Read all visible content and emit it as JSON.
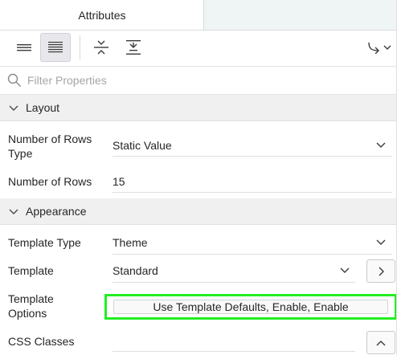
{
  "tabs": [
    {
      "label": "Attributes"
    }
  ],
  "toolbar": {
    "buttons": [
      {
        "name": "show-common-icon"
      },
      {
        "name": "show-all-icon"
      },
      {
        "name": "collapse-all-icon"
      },
      {
        "name": "expand-all-icon"
      },
      {
        "name": "go-to-group-icon"
      }
    ]
  },
  "filter": {
    "placeholder": "Filter Properties",
    "value": ""
  },
  "sections": {
    "layout": {
      "title": "Layout",
      "rows": [
        {
          "label_line1": "Number of Rows",
          "label_line2": "Type",
          "value": "Static Value"
        },
        {
          "label": "Number of Rows",
          "value": "15"
        }
      ]
    },
    "appearance": {
      "title": "Appearance",
      "rows": [
        {
          "label": "Template Type",
          "value": "Theme"
        },
        {
          "label": "Template",
          "value": "Standard"
        },
        {
          "label_line1": "Template",
          "label_line2": "Options",
          "value": "Use Template Defaults, Enable, Enable"
        },
        {
          "label": "CSS Classes",
          "value": ""
        }
      ]
    }
  },
  "colors": {
    "highlight": "#22ee22",
    "section_bg": "#f0f0f0",
    "tab_bar_bg": "#eef5f4"
  }
}
